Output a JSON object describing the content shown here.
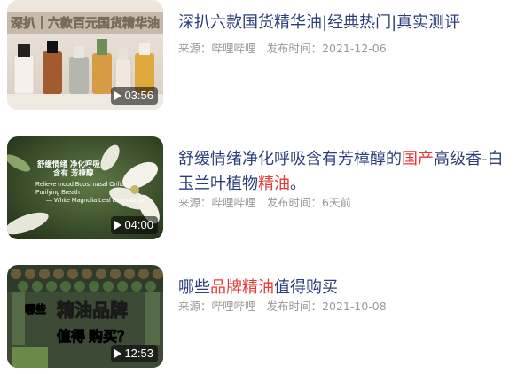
{
  "videos": [
    {
      "title": "深扒六款国货精华油|经典热门|真实测评",
      "source_label": "来源：",
      "source": "哔哩哔哩",
      "time_label": "发布时间：",
      "time": "2021-12-06",
      "duration": "03:56",
      "thumb_text": "深扒｜六款百元国货精华油"
    },
    {
      "title_parts": [
        "舒缓情绪净化呼吸含有芳樟醇的",
        "国产",
        "高级香-白玉兰叶植物",
        "精油",
        "。"
      ],
      "source_label": "来源：",
      "source": "哔哩哔哩",
      "time_label": "发布时间：",
      "time": "6天前",
      "duration": "04:00",
      "thumb_lines": [
        "舒缓情绪 净化呼吸",
        "含有 芳樟醇",
        "Relieve mood Boost nasal Orifice",
        "Purifying Breath",
        "— White Magnolia Leaf Essential oil"
      ]
    },
    {
      "title_parts": [
        "哪些",
        "品牌精油",
        "值得购买"
      ],
      "source_label": "来源：",
      "source": "哔哩哔哩",
      "time_label": "发布时间：",
      "time": "2021-10-08",
      "duration": "12:53",
      "thumb_lines": [
        "哪些",
        "精油品牌",
        "值得",
        "购买？"
      ]
    }
  ],
  "colors": {
    "title": "#2c3e7a",
    "highlight": "#e53935",
    "meta": "#9a9a9a"
  }
}
